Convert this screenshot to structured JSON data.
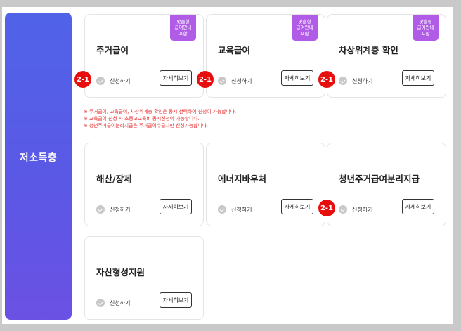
{
  "section": {
    "label": "저소득층"
  },
  "common": {
    "apply_label": "신청하기",
    "detail_label": "자세히보기"
  },
  "badge_lines": [
    "맞춤형",
    "급여안내",
    "포함"
  ],
  "marker_label": "2-1",
  "cards": [
    {
      "title": "주거급여",
      "badge": true,
      "marker": true
    },
    {
      "title": "교육급여",
      "badge": true,
      "marker": true
    },
    {
      "title": "차상위계층 확인",
      "badge": true,
      "marker": true
    },
    {
      "title": "해산/장제",
      "badge": false,
      "marker": false
    },
    {
      "title": "에너지바우처",
      "badge": false,
      "marker": false
    },
    {
      "title": "청년주거급여분리지급",
      "badge": false,
      "marker": true
    },
    {
      "title": "자산형성지원",
      "badge": false,
      "marker": false
    }
  ],
  "notes": [
    "※ 주거급여, 교육급여, 차상위계층 확인은 동시 선택하여 신청이 가능합니다.",
    "※ 교육급여 신청 시 초중고교육비 동시신청이 가능합니다.",
    "※ 청년주거급여분리지급은 주거급여수급자만 신청가능합니다."
  ]
}
